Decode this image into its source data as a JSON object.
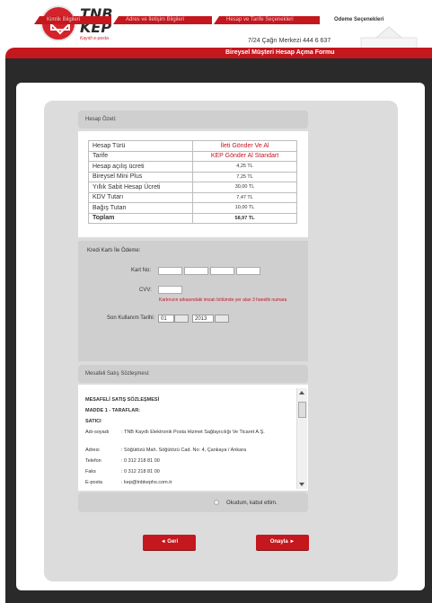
{
  "header": {
    "logo_line1": "TNB",
    "logo_line2": "KEP",
    "logo_tagline": "Kayıtlı e-posta",
    "callcenter": "7/24 Çağrı Merkezi 444 6 637",
    "form_title": "Bireysel Müşteri Hesap Açma Formu"
  },
  "tabs": [
    {
      "label": "Kimlik Bilgileri"
    },
    {
      "label": "Adres ve İletişim Bilgileri"
    },
    {
      "label": "Hesap ve Tarife Seçenekleri"
    },
    {
      "label": "Ödeme Seçenekleri"
    }
  ],
  "account_summary": {
    "heading": "Hesap Özeti:",
    "rows": [
      {
        "label": "Hesap Türü",
        "value": "İleti Gönder Ve Al"
      },
      {
        "label": "Tarife",
        "value": "KEP Gönder Al Standart"
      },
      {
        "label": "Hesap açılış ücreti",
        "value": "4,25 TL"
      },
      {
        "label": "Bireysel Mini Plus",
        "value": "7,25 TL"
      },
      {
        "label": "Yıllık Sabit Hesap Ücreti",
        "value": "30,00 TL"
      },
      {
        "label": "KDV Tutarı",
        "value": "7,47 TL"
      },
      {
        "label": "Bağış Tutarı",
        "value": "10,00 TL"
      },
      {
        "label": "Toplam",
        "value": "58,97 TL"
      }
    ]
  },
  "payment": {
    "heading": "Kredi Kartı İle Ödeme:",
    "card_label": "Kart No:",
    "cvv_label": "CVV:",
    "cvv_note": "Kartınızın arkasındaki imzalı bölümde yer alan 3 hanelik numara",
    "expiry_label": "Son Kullanım Tarihi:",
    "expiry_month": "01",
    "expiry_year": "2013"
  },
  "contract": {
    "heading": "Mesafeli Satış Sözleşmesi:",
    "title": "MESAFELİ SATIŞ SÖZLEŞMESİ",
    "article": "MADDE 1 - TARAFLAR:",
    "party": "SATICI",
    "rows": [
      {
        "k": "Adı-soyadı",
        "v": ": TNB Kayıtlı Elektronik Posta Hizmet Sağlayıcılığı Ve Ticaret A.Ş."
      },
      {
        "k": "Adresi",
        "v": ": Söğütözü Mah. Söğütözü Cad. No: 4, Çankaya / Ankara"
      },
      {
        "k": "Telefon",
        "v": ": 0 312 218 81 00"
      },
      {
        "k": "Faks",
        "v": ": 0 312 218 81 00"
      },
      {
        "k": "E-posta",
        "v": ": kep@tnbkephs.com.tr"
      }
    ],
    "accept_label": "Okudum, kabul ettim."
  },
  "buttons": {
    "back": "◄ Geri",
    "confirm": "Onayla ►"
  }
}
